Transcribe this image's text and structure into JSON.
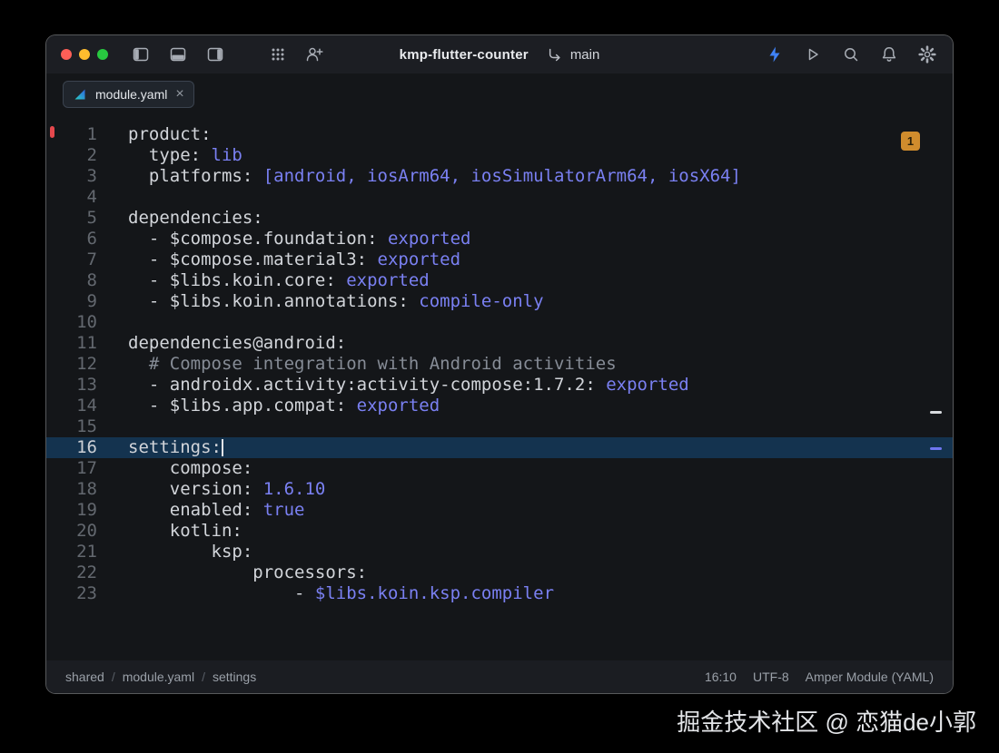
{
  "titlebar": {
    "title": "kmp-flutter-counter",
    "branch": "main"
  },
  "tabs": [
    {
      "label": "module.yaml",
      "close": "×"
    }
  ],
  "editor": {
    "error_badge": "1",
    "cursor_line": 16,
    "lines": [
      {
        "num": "1",
        "segs": [
          [
            "k",
            "product:"
          ]
        ]
      },
      {
        "num": "2",
        "segs": [
          [
            "k",
            "  type: "
          ],
          [
            "v",
            "lib"
          ]
        ]
      },
      {
        "num": "3",
        "segs": [
          [
            "k",
            "  platforms: "
          ],
          [
            "v",
            "[android, iosArm64, iosSimulatorArm64, iosX64]"
          ]
        ]
      },
      {
        "num": "4",
        "segs": []
      },
      {
        "num": "5",
        "segs": [
          [
            "k",
            "dependencies:"
          ]
        ]
      },
      {
        "num": "6",
        "segs": [
          [
            "k",
            "  - $compose.foundation: "
          ],
          [
            "v",
            "exported"
          ]
        ]
      },
      {
        "num": "7",
        "segs": [
          [
            "k",
            "  - $compose.material3: "
          ],
          [
            "v",
            "exported"
          ]
        ]
      },
      {
        "num": "8",
        "segs": [
          [
            "k",
            "  - $libs.koin.core: "
          ],
          [
            "v",
            "exported"
          ]
        ]
      },
      {
        "num": "9",
        "segs": [
          [
            "k",
            "  - $libs.koin.annotations: "
          ],
          [
            "v",
            "compile-only"
          ]
        ]
      },
      {
        "num": "10",
        "segs": []
      },
      {
        "num": "11",
        "segs": [
          [
            "k",
            "dependencies@android:"
          ]
        ]
      },
      {
        "num": "12",
        "segs": [
          [
            "c",
            "  # Compose integration with Android activities"
          ]
        ]
      },
      {
        "num": "13",
        "segs": [
          [
            "k",
            "  - androidx.activity:activity-compose:1.7.2: "
          ],
          [
            "v",
            "exported"
          ]
        ]
      },
      {
        "num": "14",
        "segs": [
          [
            "k",
            "  - $libs.app.compat: "
          ],
          [
            "v",
            "exported"
          ]
        ]
      },
      {
        "num": "15",
        "segs": []
      },
      {
        "num": "16",
        "segs": [
          [
            "k",
            "settings:"
          ]
        ]
      },
      {
        "num": "17",
        "segs": [
          [
            "k",
            "    compose:"
          ]
        ]
      },
      {
        "num": "18",
        "segs": [
          [
            "k",
            "    version: "
          ],
          [
            "v",
            "1.6.10"
          ]
        ]
      },
      {
        "num": "19",
        "segs": [
          [
            "k",
            "    enabled: "
          ],
          [
            "v",
            "true"
          ]
        ]
      },
      {
        "num": "20",
        "segs": [
          [
            "k",
            "    kotlin:"
          ]
        ]
      },
      {
        "num": "21",
        "segs": [
          [
            "k",
            "        ksp:"
          ]
        ]
      },
      {
        "num": "22",
        "segs": [
          [
            "k",
            "            processors:"
          ]
        ]
      },
      {
        "num": "23",
        "segs": [
          [
            "k",
            "                - "
          ],
          [
            "v",
            "$libs.koin.ksp.compiler"
          ]
        ]
      }
    ]
  },
  "statusbar": {
    "breadcrumbs": [
      "shared",
      "module.yaml",
      "settings"
    ],
    "separator": "/",
    "time": "16:10",
    "encoding": "UTF-8",
    "language": "Amper Module (YAML)"
  },
  "icons": {
    "window_controls": [
      "close",
      "minimize",
      "zoom"
    ],
    "titlebar_left": [
      "left-panel-toggle-icon",
      "bottom-panel-toggle-icon",
      "right-panel-toggle-icon",
      "workspace-grid-icon",
      "add-collaborator-icon"
    ],
    "branch_icon": "vcs-arrow-icon",
    "titlebar_right": [
      "smart-mode-bolt-icon",
      "run-icon",
      "search-icon",
      "notifications-bell-icon",
      "settings-gear-icon"
    ],
    "tab_icon": "amper-file-icon"
  },
  "colors": {
    "value": "#7a80f2",
    "comment": "#868c96",
    "text": "#d2d5da",
    "line-number": "#63686f",
    "current-line-bg": "#14334f",
    "accent": "#3f82f6",
    "badge-bg": "#d08c2d",
    "badge-text": "#2b2009",
    "light-red": "#ff5f57",
    "light-yellow": "#febc2e",
    "light-green": "#28c840"
  },
  "watermark": "掘金技术社区 @ 恋猫de小郭"
}
